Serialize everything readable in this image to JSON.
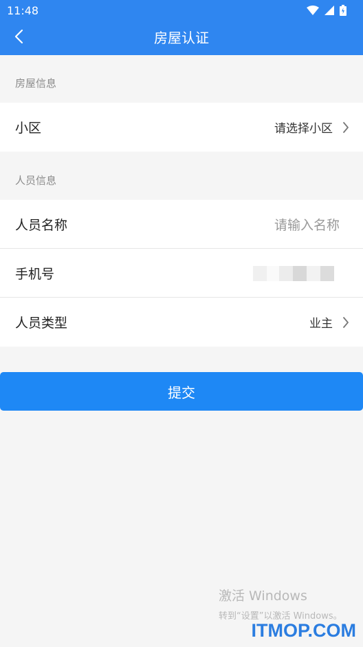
{
  "status_bar": {
    "time": "11:48",
    "icons": [
      "wifi-icon",
      "signal-icon",
      "battery-icon"
    ]
  },
  "header": {
    "title": "房屋认证",
    "back_icon": "chevron-left-icon"
  },
  "sections": {
    "house_info": {
      "header": "房屋信息",
      "community": {
        "label": "小区",
        "value": "请选择小区"
      }
    },
    "person_info": {
      "header": "人员信息",
      "name": {
        "label": "人员名称",
        "placeholder": "请输入名称"
      },
      "phone": {
        "label": "手机号"
      },
      "type": {
        "label": "人员类型",
        "value": "业主"
      }
    }
  },
  "submit_label": "提交",
  "watermark": {
    "activate_title": "激活 Windows",
    "activate_sub": "转到“设置”以激活 Windows。",
    "brand": "ITMOP.COM"
  },
  "colors": {
    "primary": "#2f86f0",
    "button": "#1e88f5",
    "background": "#f5f5f5"
  }
}
